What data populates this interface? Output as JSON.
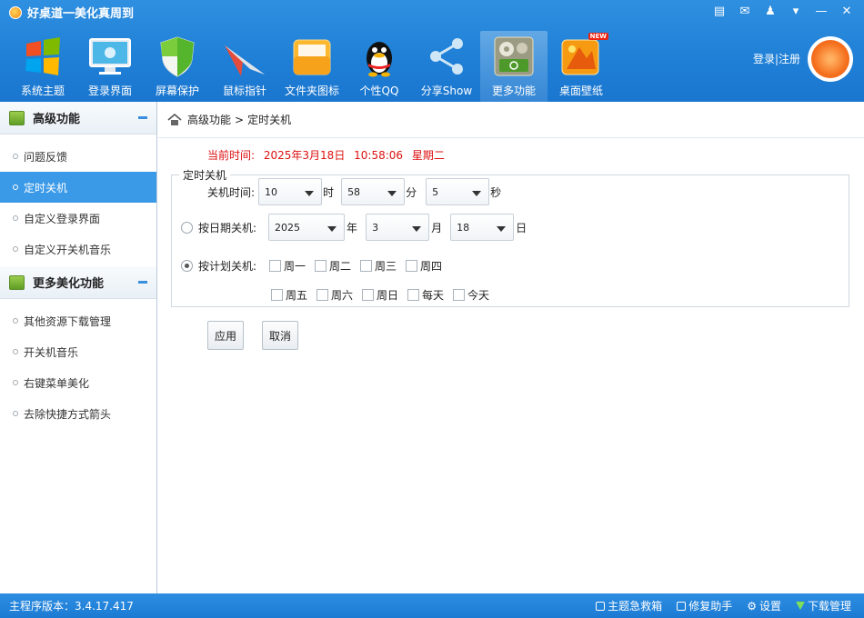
{
  "app": {
    "title": "好桌道一美化真周到"
  },
  "toolbar": {
    "items": [
      {
        "label": "系统主题",
        "icon": "windows-flag-icon"
      },
      {
        "label": "登录界面",
        "icon": "monitor-icon"
      },
      {
        "label": "屏幕保护",
        "icon": "shield-icon"
      },
      {
        "label": "鼠标指针",
        "icon": "paper-plane-icon"
      },
      {
        "label": "文件夹图标",
        "icon": "folder-icon"
      },
      {
        "label": "个性QQ",
        "icon": "qq-penguin-icon"
      },
      {
        "label": "分享Show",
        "icon": "share-icon"
      },
      {
        "label": "更多功能",
        "icon": "gear-tools-icon"
      },
      {
        "label": "桌面壁纸",
        "icon": "wallpaper-icon",
        "badge": "NEW"
      }
    ],
    "active_index": 7,
    "login_label": "登录|注册"
  },
  "sidebar": {
    "sections": [
      {
        "title": "高级功能",
        "items": [
          "问题反馈",
          "定时关机",
          "自定义登录界面",
          "自定义开关机音乐"
        ]
      },
      {
        "title": "更多美化功能",
        "items": [
          "其他资源下载管理",
          "开关机音乐",
          "右键菜单美化",
          "去除快捷方式箭头"
        ]
      }
    ],
    "active_item": "定时关机"
  },
  "main": {
    "breadcrumb": {
      "root": "高级功能",
      "sep": ">",
      "current": "定时关机"
    },
    "current_time": {
      "label": "当前时间:",
      "date": "2025年3月18日",
      "time": "10:58:06",
      "weekday": "星期二"
    },
    "group_title": "定时关机",
    "shutdown_time": {
      "label": "关机时间:",
      "hour": "10",
      "hour_unit": "时",
      "minute": "58",
      "minute_unit": "分",
      "second": "5",
      "second_unit": "秒"
    },
    "by_date": {
      "label": "按日期关机:",
      "year": "2025",
      "year_unit": "年",
      "month": "3",
      "month_unit": "月",
      "day": "18",
      "day_unit": "日",
      "selected": false
    },
    "by_plan": {
      "label": "按计划关机:",
      "selected": true,
      "days_row1": [
        "周一",
        "周二",
        "周三",
        "周四"
      ],
      "days_row2": [
        "周五",
        "周六",
        "周日",
        "每天",
        "今天"
      ]
    },
    "apply_label": "应用",
    "cancel_label": "取消"
  },
  "statusbar": {
    "version": "主程序版本：3.4.17.417",
    "links": [
      "主题急救箱",
      "修复助手",
      "设置",
      "下载管理"
    ]
  },
  "colors": {
    "accent": "#1f7fd6",
    "active_item": "#3b9ae8",
    "current_time": "#dd1111"
  }
}
